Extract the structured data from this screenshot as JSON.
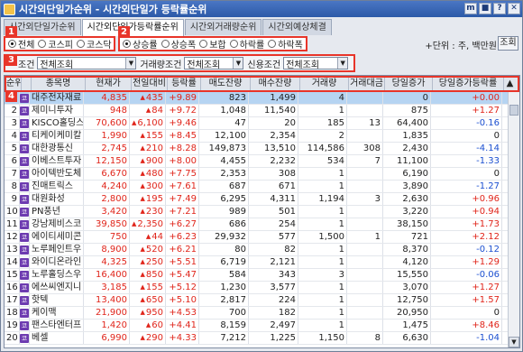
{
  "window": {
    "title": "시간외단일가순위 - 시간외단일가 등락률순위",
    "buttons": [
      "m",
      "■",
      "?",
      "✕"
    ]
  },
  "tabs": [
    "시간외단일가순위",
    "시간외단일가등락률순위",
    "시간외거래량순위",
    "시간외예상체결"
  ],
  "markers": [
    "1",
    "2",
    "3",
    "4"
  ],
  "market": {
    "options": [
      "전체",
      "코스피",
      "코스닥"
    ],
    "selected": 0
  },
  "direction": {
    "options": [
      "상승률",
      "상승폭",
      "보합",
      "하락률",
      "하락폭"
    ],
    "selected": 0
  },
  "unit_text": "+단위 : 주, 백만원",
  "query_button": "조회",
  "filters": {
    "condition_label": "조건",
    "condition_value": "전체조회",
    "volume_label": "거래량조건",
    "volume_value": "전체조회",
    "credit_label": "신용조건",
    "credit_value": "전체조회"
  },
  "colors": {
    "up": "#e0251b",
    "down": "#1b4fd0",
    "kospi_mark": "#6d3bb0",
    "kosdaq_mark": "#3d9c2c",
    "highlight": "#e8352a"
  },
  "table": {
    "headers": [
      "순위",
      "",
      "종목명",
      "현재가",
      "전일대비",
      "등락률",
      "매도잔량",
      "매수잔량",
      "거래량",
      "거래대금",
      "당일증가",
      "당일증가등락률"
    ],
    "rows": [
      {
        "rank": "1",
        "mk": "코",
        "name": "대주전자재료",
        "price": "4,835",
        "chg": "435",
        "rate": "+9.89",
        "sell": "823",
        "buy": "1,499",
        "vol": "4",
        "amt": "",
        "dvol": "0",
        "drate": "+0.00"
      },
      {
        "rank": "2",
        "mk": "코",
        "name": "제미니투자",
        "price": "948",
        "chg": "84",
        "rate": "+9.72",
        "sell": "1,048",
        "buy": "11,540",
        "vol": "1",
        "amt": "",
        "dvol": "875",
        "drate": "+1.27"
      },
      {
        "rank": "3",
        "mk": "코",
        "name": "KISCO홀딩스",
        "price": "70,600",
        "chg": "6,100",
        "rate": "+9.46",
        "sell": "47",
        "buy": "20",
        "vol": "185",
        "amt": "13",
        "dvol": "64,400",
        "drate": "-0.16"
      },
      {
        "rank": "4",
        "mk": "코",
        "name": "티케이케미칼",
        "price": "1,990",
        "chg": "155",
        "rate": "+8.45",
        "sell": "12,100",
        "buy": "2,354",
        "vol": "2",
        "amt": "",
        "dvol": "1,835",
        "drate": "0"
      },
      {
        "rank": "5",
        "mk": "코",
        "name": "대한광통신",
        "price": "2,745",
        "chg": "210",
        "rate": "+8.28",
        "sell": "149,873",
        "buy": "13,510",
        "vol": "114,586",
        "amt": "308",
        "dvol": "2,430",
        "drate": "-4.14"
      },
      {
        "rank": "6",
        "mk": "코",
        "name": "이베스트투자",
        "price": "12,150",
        "chg": "900",
        "rate": "+8.00",
        "sell": "4,455",
        "buy": "2,232",
        "vol": "534",
        "amt": "7",
        "dvol": "11,100",
        "drate": "-1.33"
      },
      {
        "rank": "7",
        "mk": "코",
        "name": "아이텍반도체",
        "price": "6,670",
        "chg": "480",
        "rate": "+7.75",
        "sell": "2,353",
        "buy": "308",
        "vol": "1",
        "amt": "",
        "dvol": "6,190",
        "drate": "0"
      },
      {
        "rank": "8",
        "mk": "코",
        "name": "진매트릭스",
        "price": "4,240",
        "chg": "300",
        "rate": "+7.61",
        "sell": "687",
        "buy": "671",
        "vol": "1",
        "amt": "",
        "dvol": "3,890",
        "drate": "-1.27"
      },
      {
        "rank": "9",
        "mk": "코",
        "name": "대원화성",
        "price": "2,800",
        "chg": "195",
        "rate": "+7.49",
        "sell": "6,295",
        "buy": "4,311",
        "vol": "1,194",
        "amt": "3",
        "dvol": "2,630",
        "drate": "+0.96"
      },
      {
        "rank": "10",
        "mk": "코",
        "name": "PN풍년",
        "price": "3,420",
        "chg": "230",
        "rate": "+7.21",
        "sell": "989",
        "buy": "501",
        "vol": "1",
        "amt": "",
        "dvol": "3,220",
        "drate": "+0.94"
      },
      {
        "rank": "11",
        "mk": "코",
        "name": "강남제비스코",
        "price": "39,850",
        "chg": "2,350",
        "rate": "+6.27",
        "sell": "686",
        "buy": "254",
        "vol": "1",
        "amt": "",
        "dvol": "38,150",
        "drate": "+1.73"
      },
      {
        "rank": "12",
        "mk": "코",
        "name": "에이티세미콘",
        "price": "750",
        "chg": "44",
        "rate": "+6.23",
        "sell": "29,932",
        "buy": "577",
        "vol": "1,500",
        "amt": "1",
        "dvol": "721",
        "drate": "+2.12"
      },
      {
        "rank": "13",
        "mk": "코",
        "name": "노루페인트우",
        "price": "8,900",
        "chg": "520",
        "rate": "+6.21",
        "sell": "80",
        "buy": "82",
        "vol": "1",
        "amt": "",
        "dvol": "8,370",
        "drate": "-0.12"
      },
      {
        "rank": "14",
        "mk": "코",
        "name": "와이디온라인",
        "price": "4,325",
        "chg": "250",
        "rate": "+5.51",
        "sell": "6,719",
        "buy": "2,121",
        "vol": "1",
        "amt": "",
        "dvol": "4,120",
        "drate": "+1.29"
      },
      {
        "rank": "15",
        "mk": "코",
        "name": "노루홀딩스우",
        "price": "16,400",
        "chg": "850",
        "rate": "+5.47",
        "sell": "584",
        "buy": "343",
        "vol": "3",
        "amt": "",
        "dvol": "15,550",
        "drate": "-0.06"
      },
      {
        "rank": "16",
        "mk": "코",
        "name": "에쓰씨엔지니",
        "price": "3,185",
        "chg": "155",
        "rate": "+5.12",
        "sell": "1,230",
        "buy": "3,577",
        "vol": "1",
        "amt": "",
        "dvol": "3,070",
        "drate": "+1.27"
      },
      {
        "rank": "17",
        "mk": "코",
        "name": "핫텍",
        "price": "13,400",
        "chg": "650",
        "rate": "+5.10",
        "sell": "2,817",
        "buy": "224",
        "vol": "1",
        "amt": "",
        "dvol": "12,750",
        "drate": "+1.57"
      },
      {
        "rank": "18",
        "mk": "코",
        "name": "케이맥",
        "price": "21,900",
        "chg": "950",
        "rate": "+4.53",
        "sell": "700",
        "buy": "182",
        "vol": "1",
        "amt": "",
        "dvol": "20,950",
        "drate": "0"
      },
      {
        "rank": "19",
        "mk": "코",
        "name": "팬스타엔터프",
        "price": "1,420",
        "chg": "60",
        "rate": "+4.41",
        "sell": "8,159",
        "buy": "2,497",
        "vol": "1",
        "amt": "",
        "dvol": "1,475",
        "drate": "+8.46"
      },
      {
        "rank": "20",
        "mk": "코",
        "name": "베셀",
        "price": "6,990",
        "chg": "290",
        "rate": "+4.33",
        "sell": "7,212",
        "buy": "1,225",
        "vol": "1,150",
        "amt": "8",
        "dvol": "6,630",
        "drate": "-1.04"
      }
    ]
  }
}
